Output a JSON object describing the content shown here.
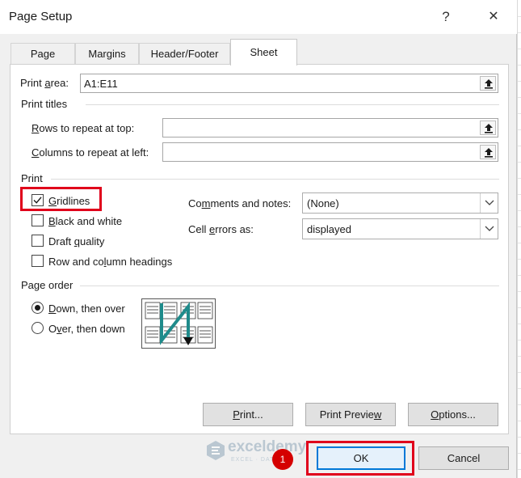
{
  "window": {
    "title": "Page Setup",
    "help_glyph": "?",
    "close_glyph": "✕"
  },
  "tabs": [
    {
      "label": "Page",
      "active": false
    },
    {
      "label": "Margins",
      "active": false
    },
    {
      "label": "Header/Footer",
      "active": false
    },
    {
      "label": "Sheet",
      "active": true
    }
  ],
  "print_area": {
    "label_pre": "Print ",
    "label_access": "a",
    "label_post": "rea:",
    "value": "A1:E11"
  },
  "print_titles": {
    "heading": "Print titles",
    "rows": {
      "label_access": "R",
      "label_post": "ows to repeat at top:",
      "value": ""
    },
    "columns": {
      "label_access": "C",
      "label_post": "olumns to repeat at left:",
      "value": ""
    }
  },
  "print": {
    "heading": "Print",
    "gridlines": {
      "label_pre": "",
      "label_access": "G",
      "label_post": "ridlines",
      "checked": true
    },
    "black_and_white": {
      "label_pre": "",
      "label_access": "B",
      "label_post": "lack and white",
      "checked": false
    },
    "draft_quality": {
      "label_pre": "Draft ",
      "label_access": "q",
      "label_post": "uality",
      "checked": false
    },
    "row_col_headings": {
      "label_pre": "Row and co",
      "label_access": "l",
      "label_post": "umn headings",
      "checked": false
    },
    "comments": {
      "label_pre": "Co",
      "label_access": "m",
      "label_post": "ments and notes:",
      "value": "(None)"
    },
    "cell_errors": {
      "label_pre": "Cell ",
      "label_access": "e",
      "label_post": "rrors as:",
      "value": "displayed"
    }
  },
  "page_order": {
    "heading": "Page order",
    "down_then_over": {
      "label_pre": "",
      "label_access": "D",
      "label_post": "own, then over",
      "selected": true
    },
    "over_then_down": {
      "label_pre": "O",
      "label_access": "v",
      "label_post": "er, then down",
      "selected": false
    }
  },
  "buttons": {
    "print": {
      "label_pre": "",
      "label_access": "P",
      "label_post": "rint..."
    },
    "print_preview": {
      "label_pre": "Print Previe",
      "label_access": "w",
      "label_post": ""
    },
    "options": {
      "label_pre": "",
      "label_access": "O",
      "label_post": "ptions..."
    },
    "ok": "OK",
    "cancel": "Cancel"
  },
  "annotation": {
    "step_number": "1",
    "highlight_color": "#e0001b",
    "badge_color": "#d50000"
  },
  "watermark": {
    "name": "exceldemy",
    "tagline": "EXCEL · DATA · BI"
  },
  "colors": {
    "accent": "#0078d7",
    "page_order_arrow": "#1f8b8b"
  }
}
